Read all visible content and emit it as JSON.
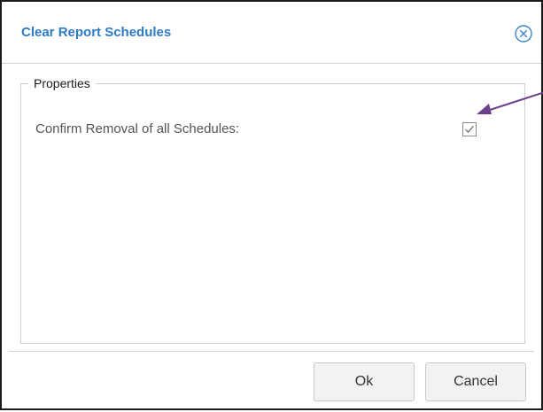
{
  "dialog": {
    "title": "Clear Report Schedules",
    "close_icon": "close-circle-icon"
  },
  "properties": {
    "legend": "Properties",
    "confirm_label": "Confirm Removal of all Schedules:",
    "confirm_checked": true
  },
  "annotation": {
    "arrow_color": "#6b3f8a"
  },
  "buttons": {
    "ok_label": "Ok",
    "cancel_label": "Cancel"
  },
  "colors": {
    "title": "#2e7bc4",
    "border": "#1a1a1a",
    "button_bg": "#f2f2f2"
  }
}
